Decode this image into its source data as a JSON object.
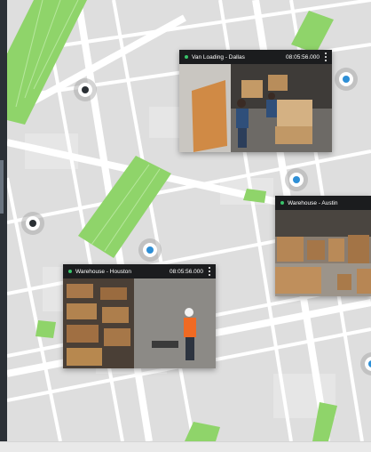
{
  "colors": {
    "park": "#8fd46a",
    "block": "#dedede",
    "road": "#ffffff",
    "pin_blue": "#2e8fd6",
    "pin_dark": "#2a2f34",
    "live_dot": "#39c46b",
    "feed_header": "#1b1c1e"
  },
  "feeds": [
    {
      "title": "Van Loading - Dallas",
      "time": "08:05:56.000"
    },
    {
      "title": "Warehouse - Austin",
      "time": ""
    },
    {
      "title": "Warehouse - Houston",
      "time": "08:05:56.000"
    }
  ],
  "icons": {
    "live": "live-indicator-icon",
    "menu": "kebab-menu-icon",
    "pin": "map-pin-icon"
  }
}
